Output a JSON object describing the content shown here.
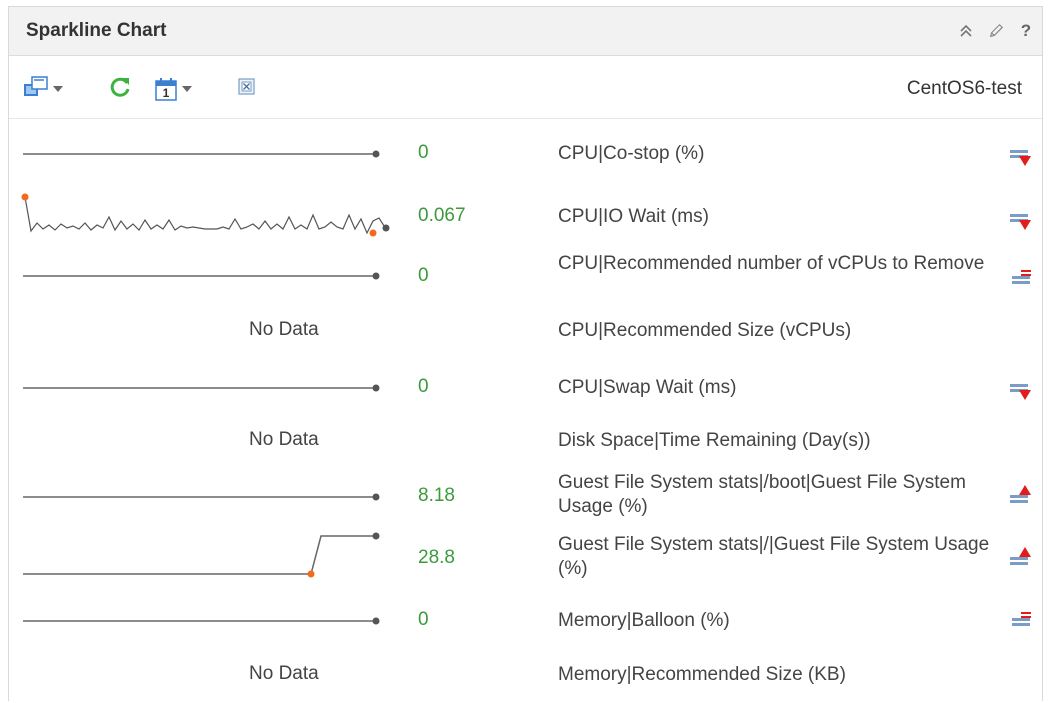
{
  "header": {
    "title": "Sparkline Chart",
    "actions": [
      {
        "icon": "collapse-icon",
        "glyph": "⌃"
      },
      {
        "icon": "edit-icon",
        "glyph": "✎"
      },
      {
        "icon": "help-icon",
        "glyph": "?"
      }
    ]
  },
  "toolbar": {
    "resource_name": "CentOS6-test",
    "buttons": [
      {
        "icon": "select-resource-icon"
      },
      {
        "icon": "refresh-icon"
      },
      {
        "icon": "calendar-icon",
        "day": "1"
      },
      {
        "icon": "reset-icon"
      }
    ]
  },
  "colors": {
    "value_green": "#3c9a3c",
    "line_gray": "#666666",
    "marker_orange": "#f26a1b",
    "trend_red": "#e21b1b"
  },
  "metrics": [
    {
      "label": "CPU|Co-stop (%)",
      "value": "0",
      "trend": "down",
      "spark": "flat"
    },
    {
      "label": "CPU|IO Wait (ms)",
      "value": "0.067",
      "trend": "down",
      "spark": "noisy"
    },
    {
      "label": "CPU|Recommended number of vCPUs to Remove",
      "value": "0",
      "trend": "flat",
      "spark": "flat"
    },
    {
      "label": "CPU|Recommended Size (vCPUs)",
      "value": "No Data",
      "trend": "none",
      "spark": "none"
    },
    {
      "label": "CPU|Swap Wait (ms)",
      "value": "0",
      "trend": "down",
      "spark": "flat"
    },
    {
      "label": "Disk Space|Time Remaining (Day(s))",
      "value": "No Data",
      "trend": "none",
      "spark": "none"
    },
    {
      "label": "Guest File System stats|/boot|Guest File System Usage (%)",
      "value": "8.18",
      "trend": "up",
      "spark": "flat"
    },
    {
      "label": "Guest File System stats|/|Guest File System Usage (%)",
      "value": "28.8",
      "trend": "up",
      "spark": "step"
    },
    {
      "label": "Memory|Balloon (%)",
      "value": "0",
      "trend": "flat",
      "spark": "flat"
    },
    {
      "label": "Memory|Recommended Size (KB)",
      "value": "No Data",
      "trend": "none",
      "spark": "none"
    }
  ]
}
